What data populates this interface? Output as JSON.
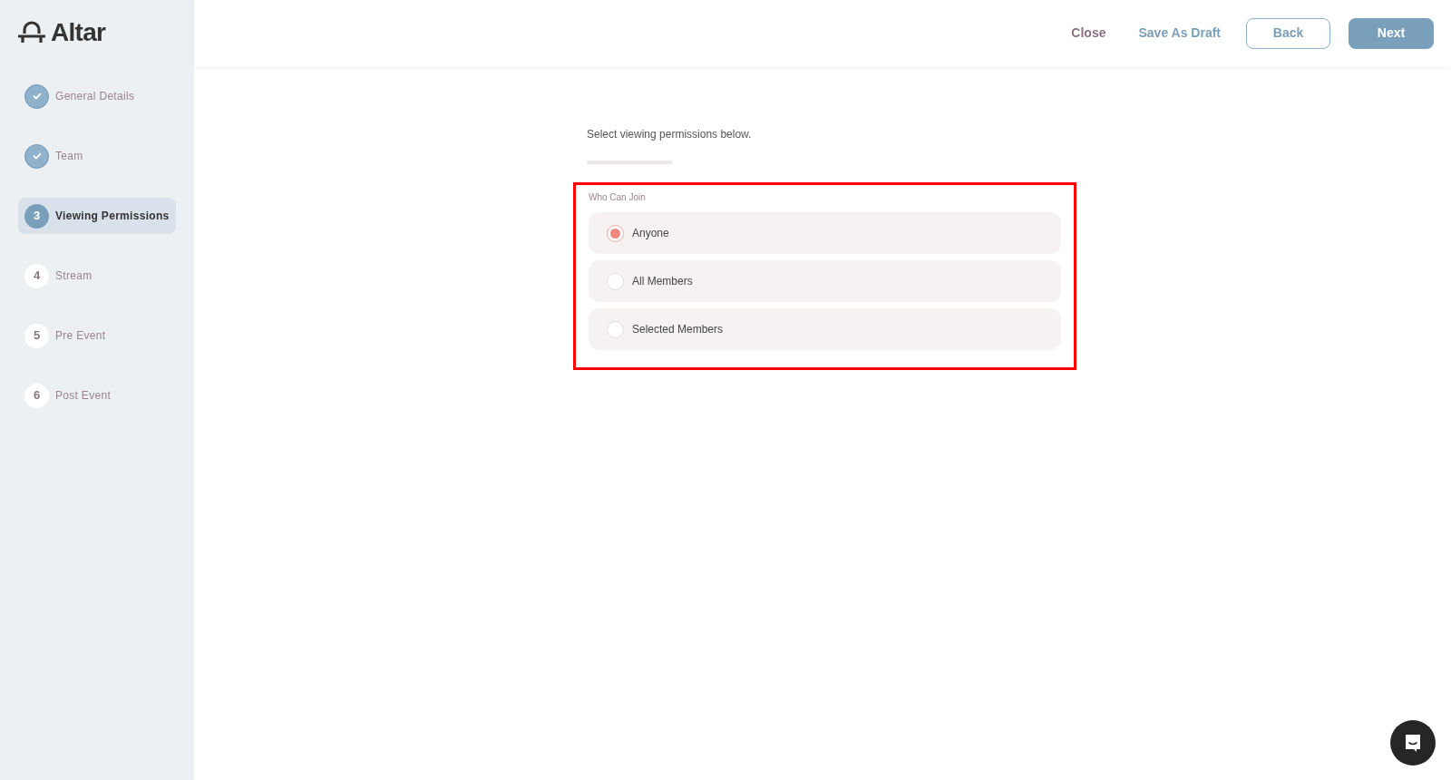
{
  "logo": {
    "text": "Altar"
  },
  "steps": [
    {
      "label": "General Details",
      "done": true,
      "selected": false
    },
    {
      "label": "Team",
      "done": true,
      "selected": false
    },
    {
      "marker": "3",
      "label": "Viewing Permissions",
      "done": false,
      "selected": true
    },
    {
      "marker": "4",
      "label": "Stream",
      "done": false,
      "selected": false
    },
    {
      "marker": "5",
      "label": "Pre Event",
      "done": false,
      "selected": false
    },
    {
      "marker": "6",
      "label": "Post Event",
      "done": false,
      "selected": false
    }
  ],
  "header": {
    "actions": [
      {
        "label": "Close",
        "kind": "link-muted"
      },
      {
        "label": "Save As Draft",
        "kind": "link"
      },
      {
        "label": "Back",
        "kind": "outline"
      },
      {
        "label": "Next",
        "kind": "filled"
      }
    ]
  },
  "intro": "Select viewing permissions below.",
  "section": {
    "label": "Who Can Join",
    "highlighted": true,
    "options": [
      {
        "label": "Anyone",
        "selected": true
      },
      {
        "label": "All Members",
        "selected": false
      },
      {
        "label": "Selected Members",
        "selected": false
      }
    ]
  }
}
